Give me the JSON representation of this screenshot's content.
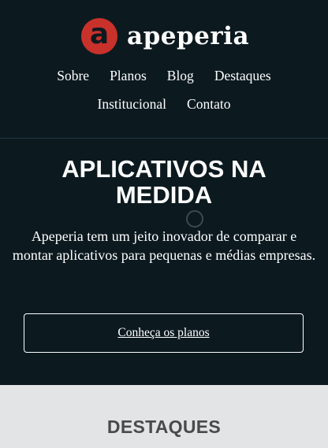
{
  "brand": {
    "logo_letter": "a",
    "name": "apeperia",
    "accent_color": "#c9312b"
  },
  "nav": {
    "items": [
      {
        "label": "Sobre"
      },
      {
        "label": "Planos"
      },
      {
        "label": "Blog"
      },
      {
        "label": "Destaques"
      },
      {
        "label": "Institucional"
      },
      {
        "label": "Contato"
      }
    ]
  },
  "hero": {
    "title_line1": "APLICATIVOS NA",
    "title_line2": "MEDIDA",
    "description": "Apeperia tem um jeito inovador de comparar e montar aplicativos para pequenas e médias empresas.",
    "cta_label": "Conheça os planos"
  },
  "featured": {
    "title": "DESTAQUES"
  }
}
